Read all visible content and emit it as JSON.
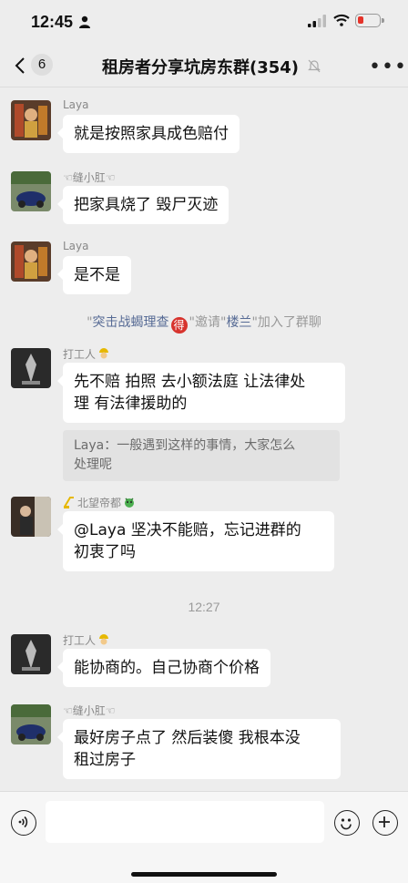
{
  "status": {
    "time": "12:45"
  },
  "header": {
    "unread_count": "6",
    "title": "租房者分享坑房东群(354)"
  },
  "messages": [
    {
      "sender": "Laya",
      "text": "就是按照家具成色赔付"
    },
    {
      "sender": "☜缝小肛☜",
      "text": "把家具烧了 毁尸灭迹"
    },
    {
      "sender": "Laya",
      "text": "是不是"
    },
    {
      "sender": "打工人",
      "line1": "先不赔 拍照 去小额法庭 让法律处",
      "line2": "理 有法律援助的",
      "quote_line1": "Laya：一般遇到这样的事情，大家怎么",
      "quote_line2": "处理呢"
    },
    {
      "sender": "北望帝都",
      "line1": "@Laya 坚决不能赔，忘记进群的",
      "line2": "初衷了吗"
    },
    {
      "sender": "打工人",
      "text": "能协商的。自己协商个价格"
    },
    {
      "sender": "☜缝小肛☜",
      "line1": "最好房子点了 然后装傻 我根本没",
      "line2": "租过房子"
    }
  ],
  "system": {
    "q1": "\"",
    "inviter": "突击战蝎理查",
    "stamp": "得",
    "q2": "\"邀请\"",
    "invitee": "楼兰",
    "q3": "\"加入了群聊"
  },
  "timestamp": "12:27",
  "icons": {
    "back": "chevron-left-icon",
    "mute": "mute-bell-icon",
    "more": "more-dots-icon",
    "voice": "voice-icon",
    "emoji": "emoji-icon",
    "plus": "plus-icon"
  }
}
